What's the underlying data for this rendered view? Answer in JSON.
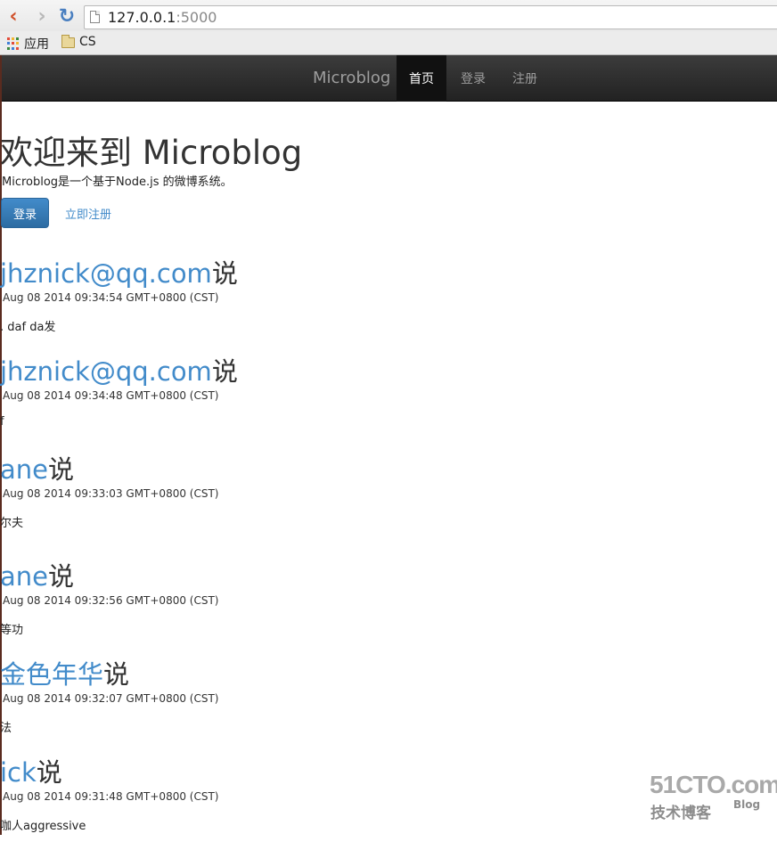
{
  "browser": {
    "url_host": "127.0.0.1",
    "url_port": ":5000",
    "bookmarks": [
      {
        "label": "应用"
      },
      {
        "label": "CS"
      }
    ]
  },
  "navbar": {
    "brand": "Microblog",
    "items": [
      {
        "label": "首页"
      },
      {
        "label": "登录"
      },
      {
        "label": "注册"
      }
    ]
  },
  "hero": {
    "title": "欢迎来到 Microblog",
    "lead": "Microblog是一个基于Node.js 的微博系统。",
    "login_button": "登录",
    "register_link": "立即注册"
  },
  "posts": [
    {
      "user": "jhznick@qq.com",
      "said": "说",
      "time": "Aug 08 2014 09:34:54 GMT+0800 (CST)",
      "content": ". daf da发"
    },
    {
      "user": "jhznick@qq.com",
      "said": "说",
      "time": "Aug 08 2014 09:34:48 GMT+0800 (CST)",
      "content": "f"
    },
    {
      "user": "ane",
      "said": "说",
      "time": "Aug 08 2014 09:33:03 GMT+0800 (CST)",
      "content": "尔夫"
    },
    {
      "user": "ane",
      "said": "说",
      "time": "Aug 08 2014 09:32:56 GMT+0800 (CST)",
      "content": "等功"
    },
    {
      "user": "金色年华",
      "said": "说",
      "time": "Aug 08 2014 09:32:07 GMT+0800 (CST)",
      "content": "法"
    },
    {
      "user": "ick",
      "said": "说",
      "time": "Aug 08 2014 09:31:48 GMT+0800 (CST)",
      "content": "咖人aggressive"
    }
  ],
  "watermark": {
    "main": "51CTO.com",
    "sub": "技术博客",
    "blog": "Blog"
  }
}
